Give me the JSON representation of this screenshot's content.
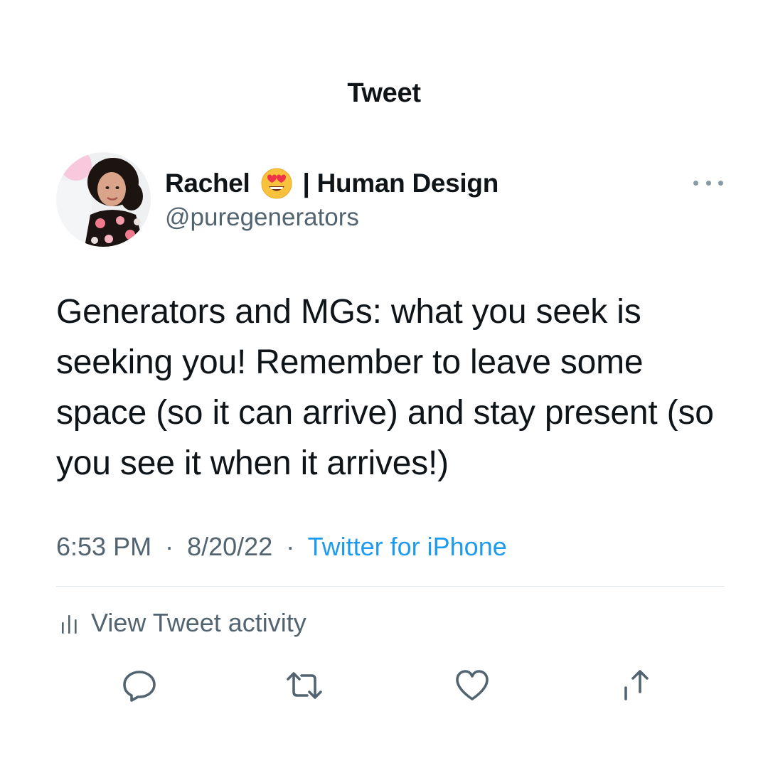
{
  "header": {
    "title": "Tweet"
  },
  "author": {
    "name": "Rachel",
    "emoji": "heart-eyes-emoji",
    "name_suffix": "| Human Design",
    "handle": "@puregenerators"
  },
  "tweet": {
    "text": "Generators and MGs: what you seek is seeking you! Remember to leave some space (so it can arrive) and stay present (so you see it when it arrives!)",
    "time": "6:53 PM",
    "separator": "·",
    "date": "8/20/22",
    "source": "Twitter for iPhone"
  },
  "activity": {
    "label": "View Tweet activity"
  },
  "actions": {
    "reply": "reply-icon",
    "retweet": "retweet-icon",
    "like": "like-icon",
    "share": "share-icon"
  },
  "colors": {
    "text": "#0f1419",
    "secondary": "#536471",
    "link": "#1d9bf0",
    "divider": "#e1e6ea"
  }
}
